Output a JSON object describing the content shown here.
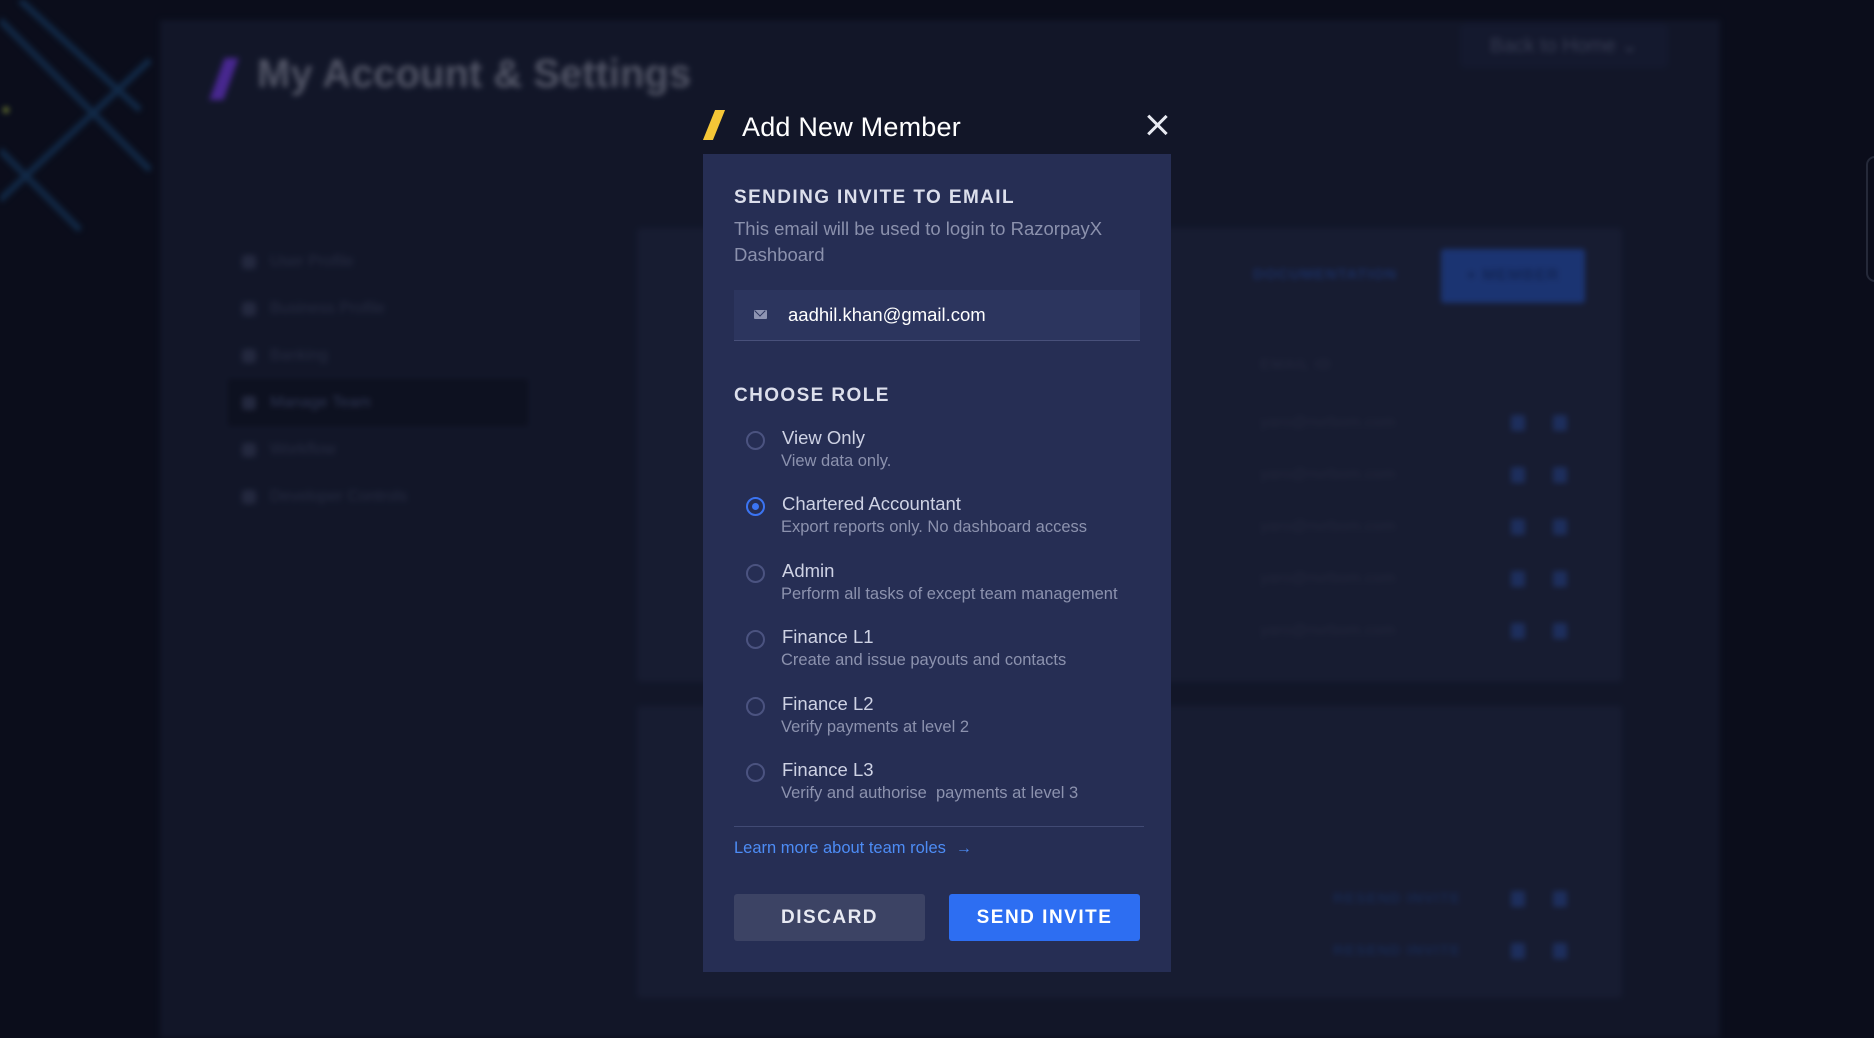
{
  "background": {
    "page_title": "My Account & Settings",
    "back_button": "Back to Home ⌄",
    "sidebar": [
      {
        "label": "User Profile"
      },
      {
        "label": "Business Profile"
      },
      {
        "label": "Banking"
      },
      {
        "label": "Manage Team",
        "active": true
      },
      {
        "label": "Workflow"
      },
      {
        "label": "Developer Controls"
      }
    ],
    "documentation": "DOCUMENTATION",
    "member_button": "+ MEMBER",
    "email_column": "EMAIL ID",
    "emails": [
      "yaro@nvrbom.com",
      "yaro@nvrbom.com",
      "yaro@nvrbom.com",
      "yaro@nvrbom.com",
      "yaro@nvrbom.com"
    ],
    "resend_invite": [
      "RESEND INVITE",
      "RESEND INVITE"
    ]
  },
  "modal": {
    "title": "Add New Member",
    "email_section": {
      "heading": "SENDING INVITE TO EMAIL",
      "helper": "This email will be used to login to RazorpayX Dashboard",
      "value": "aadhil.khan@gmail.com"
    },
    "role_section": {
      "heading": "CHOOSE ROLE",
      "roles": [
        {
          "name": "View Only",
          "description": "View data only.",
          "selected": false
        },
        {
          "name": "Chartered Accountant",
          "description": "Export reports only. No dashboard access",
          "selected": true
        },
        {
          "name": "Admin",
          "description": "Perform all tasks of except team management",
          "selected": false
        },
        {
          "name": "Finance L1",
          "description": "Create and issue payouts and contacts",
          "selected": false
        },
        {
          "name": "Finance L2",
          "description": "Verify payments at level 2",
          "selected": false
        },
        {
          "name": "Finance L3",
          "description": "Verify and authorise  payments at level 3",
          "selected": false
        }
      ]
    },
    "learn_more": "Learn more about team roles",
    "discard_label": "DISCARD",
    "send_label": "SEND INVITE"
  },
  "colors": {
    "accent_blue": "#2d6ef2",
    "logo_yellow": "#f5c637",
    "modal_bg": "#262e54"
  }
}
